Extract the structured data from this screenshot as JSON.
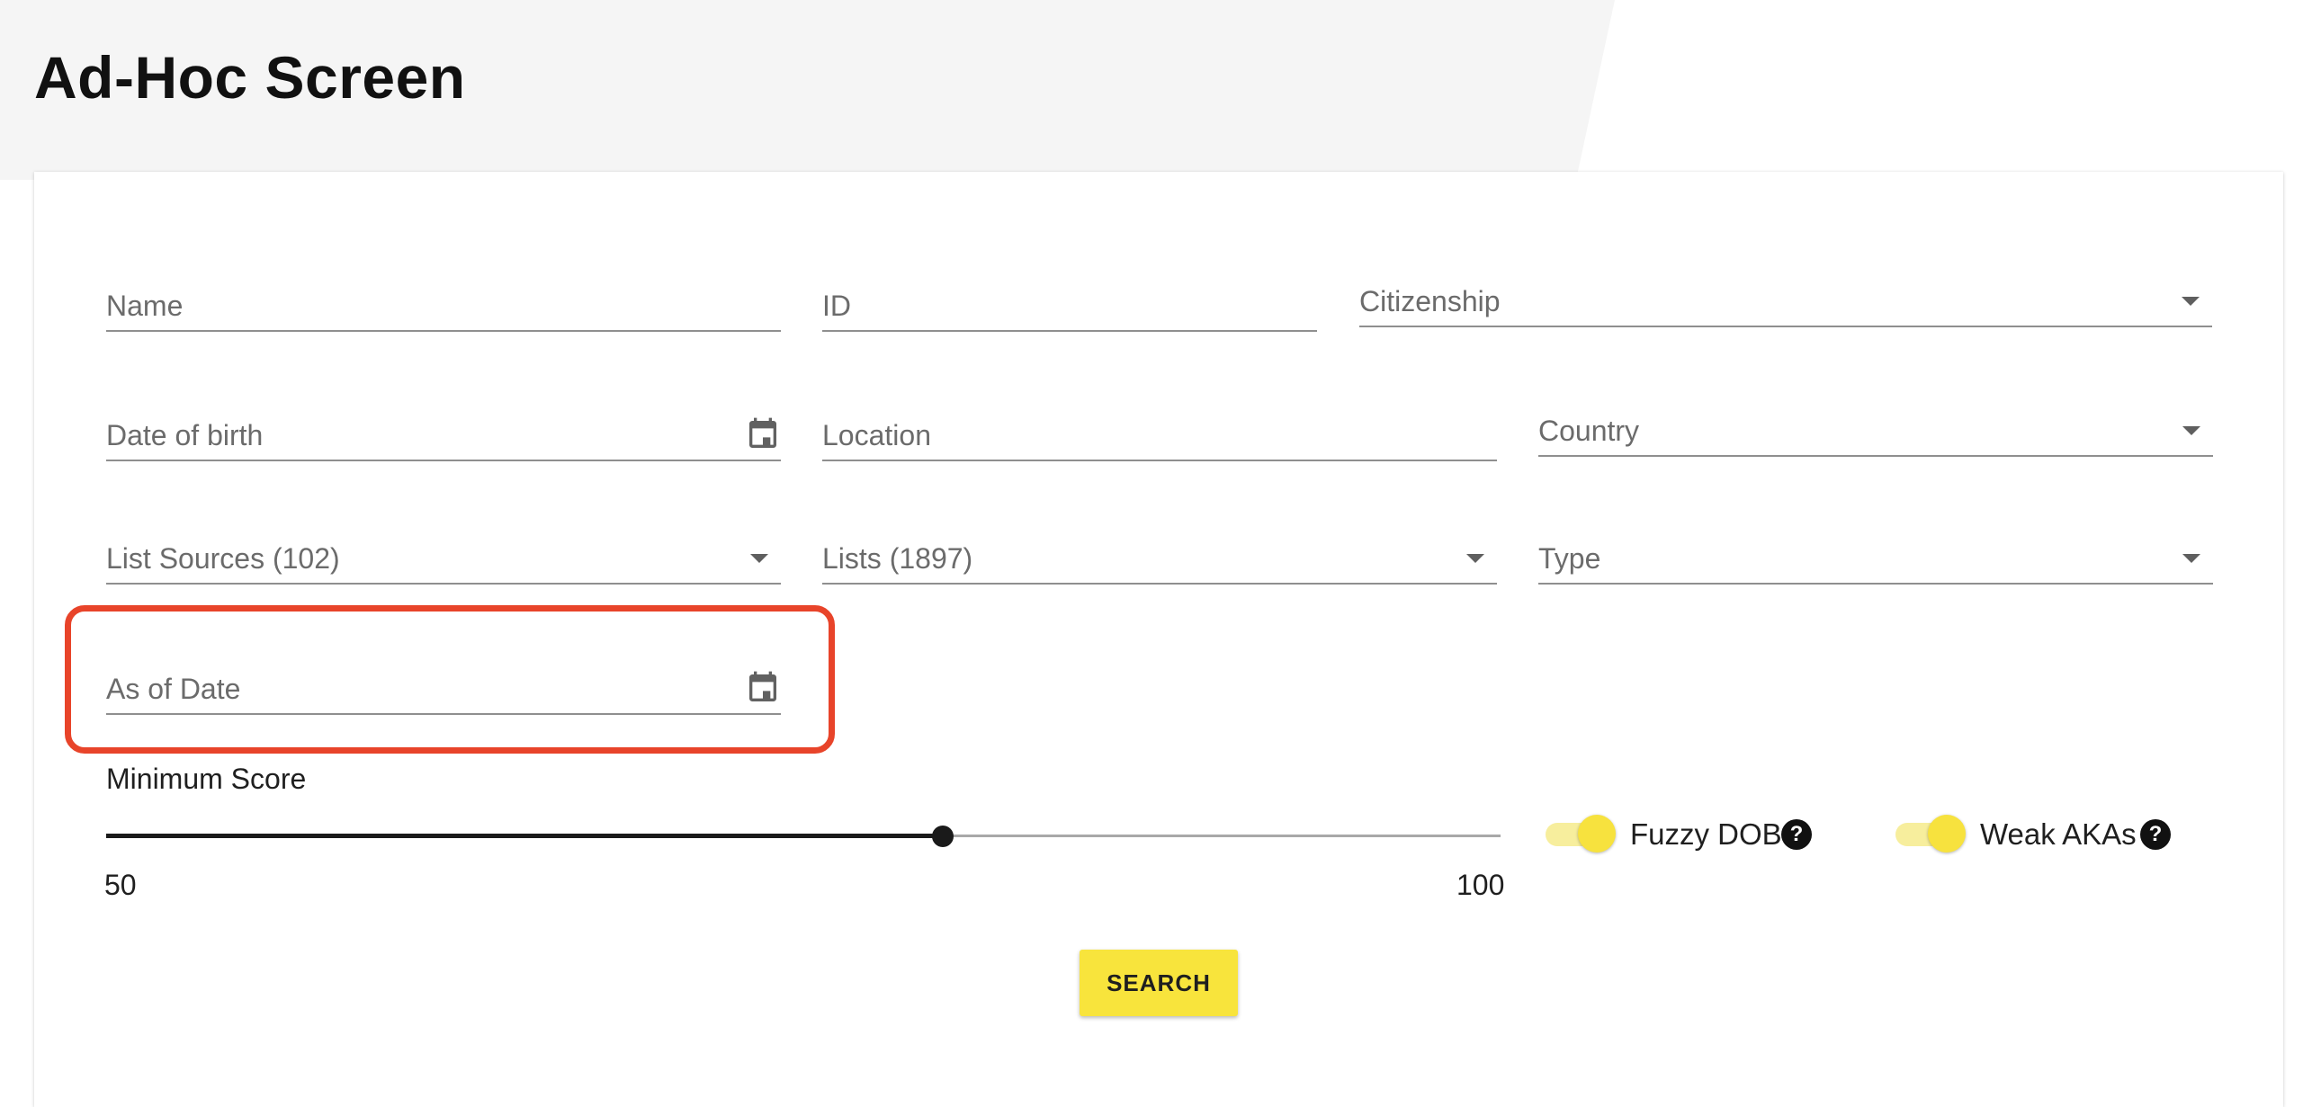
{
  "page": {
    "title": "Ad-Hoc Screen"
  },
  "form": {
    "name": {
      "label": "Name"
    },
    "id": {
      "label": "ID"
    },
    "citizenship": {
      "label": "Citizenship"
    },
    "date_of_birth": {
      "label": "Date of birth",
      "icon": "calendar-icon"
    },
    "location": {
      "label": "Location"
    },
    "country": {
      "label": "Country"
    },
    "list_sources": {
      "label": "List Sources (102)"
    },
    "lists": {
      "label": "Lists (1897)"
    },
    "type": {
      "label": "Type"
    },
    "as_of_date": {
      "label": "As of Date",
      "icon": "calendar-icon"
    }
  },
  "min_score": {
    "label": "Minimum Score",
    "min": 50,
    "max": 100,
    "min_label": "50",
    "max_label": "100",
    "value": 80
  },
  "toggles": {
    "fuzzy_dob": {
      "label": "Fuzzy DOB",
      "on": true,
      "help": "?"
    },
    "weak_akas": {
      "label": "Weak AKAs",
      "on": true,
      "help": "?"
    }
  },
  "search_button": {
    "label": "SEARCH"
  },
  "colors": {
    "accent": "#f8e43c",
    "highlight": "#e8442a",
    "toggle_track": "#f7ee9d",
    "toggle_thumb": "#f7e23e"
  }
}
